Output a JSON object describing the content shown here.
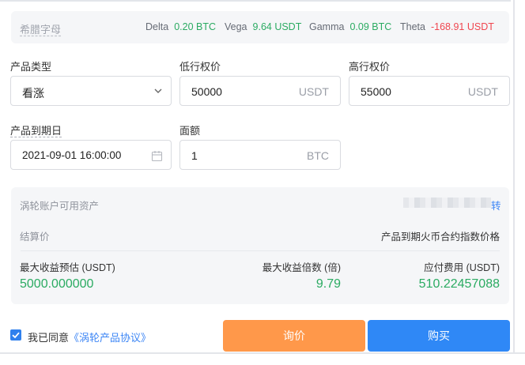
{
  "greeks": {
    "title": "希腊字母",
    "items": [
      {
        "name": "Delta",
        "value": "0.20 BTC"
      },
      {
        "name": "Vega",
        "value": "9.64 USDT"
      },
      {
        "name": "Gamma",
        "value": "0.09 BTC"
      },
      {
        "name": "Theta",
        "value": "-168.91 USDT"
      }
    ]
  },
  "form": {
    "product_type": {
      "label": "产品类型",
      "value": "看涨"
    },
    "low_strike": {
      "label": "低行权价",
      "value": "50000",
      "unit": "USDT"
    },
    "high_strike": {
      "label": "高行权价",
      "value": "55000",
      "unit": "USDT"
    },
    "expiry": {
      "label": "产品到期日",
      "value": "2021-09-01 16:00:00"
    },
    "amount": {
      "label": "面额",
      "value": "1",
      "unit": "BTC"
    }
  },
  "info": {
    "available_label": "涡轮账户可用资产",
    "available_link": "转",
    "settlement_label": "结算价",
    "settlement_value": "产品到期火币合约指数价格",
    "max_profit_label": "最大收益预估 (USDT)",
    "max_profit_value": "5000.000000",
    "max_multiple_label": "最大收益倍数 (倍)",
    "max_multiple_value": "9.79",
    "fee_label": "应付费用 (USDT)",
    "fee_value": "510.22457088"
  },
  "agreement": {
    "prefix": "我已同意",
    "link": "《涡轮产品协议》",
    "checked": true
  },
  "buttons": {
    "inquiry": "询价",
    "buy": "购买"
  },
  "colors": {
    "positive": "#2bab62",
    "negative": "#f0464f",
    "inquiry": "#ff984a",
    "buy": "#2f88f6",
    "link": "#3d86f5"
  }
}
